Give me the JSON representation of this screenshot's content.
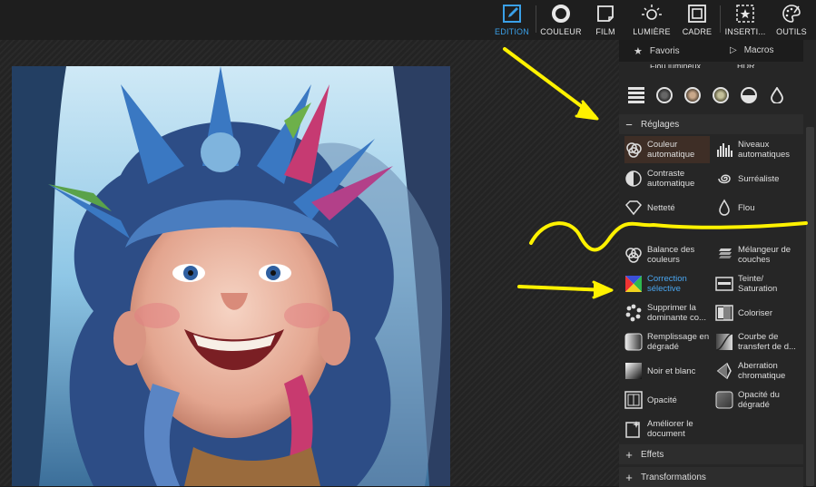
{
  "toolbar": {
    "tools": [
      {
        "label": "EDITION",
        "icon": "edit-icon"
      },
      {
        "label": "COULEUR",
        "icon": "circle-icon"
      },
      {
        "label": "FILM",
        "icon": "film-icon"
      },
      {
        "label": "LUMIÈRE",
        "icon": "sun-icon"
      },
      {
        "label": "CADRE",
        "icon": "frame-icon"
      },
      {
        "label": "INSERTI...",
        "icon": "insert-star-icon"
      },
      {
        "label": "OUTILS",
        "icon": "palette-icon"
      }
    ],
    "active": "EDITION",
    "accent": "#3aa0e8"
  },
  "panel": {
    "tabs": {
      "favorites": "Favoris",
      "macros": "Macros"
    },
    "partial_top": {
      "left": "Flou lumineux",
      "right": "HDR"
    },
    "sections": {
      "reglages": "Réglages",
      "effets": "Effets",
      "transformations": "Transformations"
    },
    "reglages_items": [
      {
        "label": "Couleur automatique",
        "icon": "auto-color-icon"
      },
      {
        "label": "Niveaux automatiques",
        "icon": "auto-levels-icon"
      },
      {
        "label": "Contraste automatique",
        "icon": "auto-contrast-icon"
      },
      {
        "label": "Surréaliste",
        "icon": "swirl-icon"
      },
      {
        "label": "Netteté",
        "icon": "sharpen-diamond-icon"
      },
      {
        "label": "Flou",
        "icon": "blur-drop-icon"
      },
      {
        "label": "Balance des couleurs",
        "icon": "color-balance-icon"
      },
      {
        "label": "Mélangeur de couches",
        "icon": "channel-mixer-icon"
      },
      {
        "label": "Correction sélective",
        "icon": "selective-correction-icon"
      },
      {
        "label": "Teinte/ Saturation",
        "icon": "hue-saturation-icon"
      },
      {
        "label": "Supprimer la dominante co...",
        "icon": "remove-cast-icon"
      },
      {
        "label": "Coloriser",
        "icon": "colorize-icon"
      },
      {
        "label": "Remplissage en dégradé",
        "icon": "gradient-fill-icon"
      },
      {
        "label": "Courbe de transfert de d...",
        "icon": "curve-icon"
      },
      {
        "label": "Noir et blanc",
        "icon": "black-white-icon"
      },
      {
        "label": "Aberration chromatique",
        "icon": "chromatic-aberration-icon"
      },
      {
        "label": "Opacité",
        "icon": "opacity-icon"
      },
      {
        "label": "Opacité du dégradé",
        "icon": "gradient-opacity-icon"
      },
      {
        "label": "Améliorer le document",
        "icon": "enhance-document-icon"
      }
    ],
    "selected_item": "Correction sélective",
    "highlighted_item": "Couleur automatique"
  },
  "annotation_color": "#fff200"
}
